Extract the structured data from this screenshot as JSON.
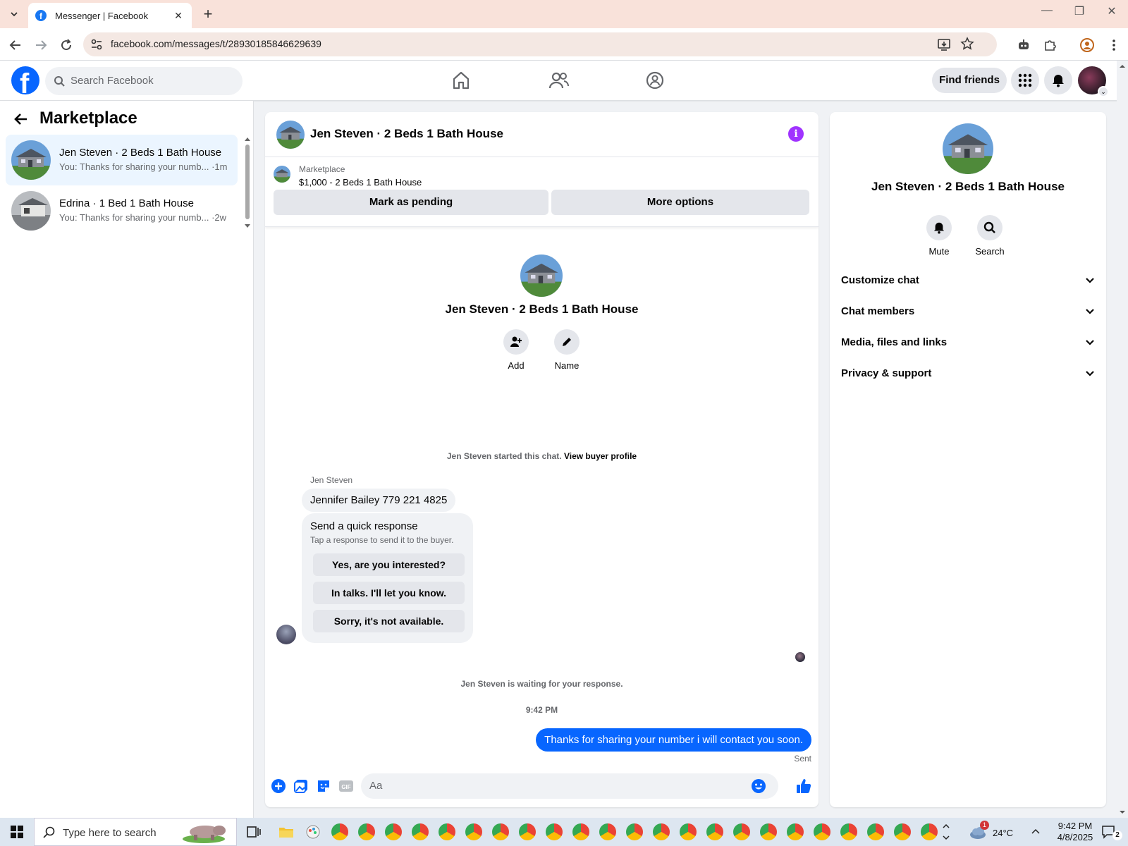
{
  "browser": {
    "tab_title": "Messenger | Facebook",
    "url": "facebook.com/messages/t/28930185846629639"
  },
  "fb": {
    "logo_letter": "f",
    "search_placeholder": "Search Facebook",
    "find_friends": "Find friends"
  },
  "left": {
    "title": "Marketplace",
    "conversations": [
      {
        "name": "Jen Steven · 2 Beds 1 Bath House",
        "snippet": "You: Thanks for sharing your numb... ·1m",
        "active": true
      },
      {
        "name": "Edrina · 1 Bed 1 Bath House",
        "snippet": "You: Thanks for sharing your numb... ·2w",
        "active": false
      }
    ]
  },
  "chat": {
    "title": "Jen Steven · 2 Beds 1 Bath House",
    "listing_label": "Marketplace",
    "listing_price": "$1,000 - 2 Beds 1 Bath House",
    "mark_pending": "Mark as pending",
    "more_options": "More options",
    "intro_name": "Jen Steven · 2 Beds 1 Bath House",
    "add_label": "Add",
    "name_label": "Name",
    "started_text": "Jen Steven started this chat.",
    "view_buyer": "View buyer profile",
    "sender_name": "Jen Steven",
    "incoming_message": "Jennifer Bailey 779 221 4825",
    "quick_title": "Send a quick response",
    "quick_subtitle": "Tap a response to send it to the buyer.",
    "quick_responses": [
      "Yes, are you interested?",
      "In talks. I'll let you know.",
      "Sorry, it's not available."
    ],
    "waiting_text": "Jen Steven is waiting for your response.",
    "timestamp": "9:42 PM",
    "outgoing_message": "Thanks for sharing your number i will contact you soon.",
    "sent_label": "Sent",
    "composer_placeholder": "Aa",
    "gif_label": "GIF"
  },
  "details": {
    "name": "Jen Steven · 2 Beds 1 Bath House",
    "mute": "Mute",
    "search": "Search",
    "sections": [
      "Customize chat",
      "Chat members",
      "Media, files and links",
      "Privacy & support"
    ]
  },
  "taskbar": {
    "search_placeholder": "Type here to search",
    "weather": "24°C",
    "weather_badge": "1",
    "time": "9:42 PM",
    "date": "4/8/2025",
    "notifications": "2"
  },
  "colors": {
    "accent": "#0866ff",
    "info": "#a033ff",
    "chrome_tab_strip": "#f9e2da"
  }
}
